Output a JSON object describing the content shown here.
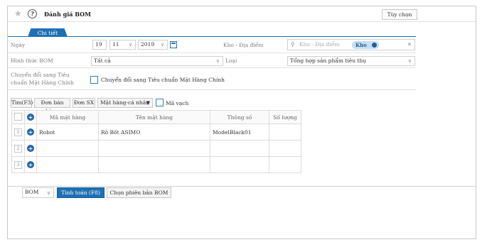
{
  "header": {
    "title": "Đánh giá BOM",
    "options_label": "Tùy chọn",
    "help_glyph": "?",
    "star_glyph": "★"
  },
  "tabs": [
    {
      "label": "Chi tiết"
    }
  ],
  "form": {
    "date_label": "Ngày",
    "date_day": "19",
    "date_month": "11",
    "date_year": "2019",
    "warehouse_label": "Kho - Địa điểm",
    "warehouse_placeholder": "Kho - Địa điểm",
    "warehouse_tag": "Kho",
    "bom_type_label": "Hình thức BOM",
    "bom_type_value": "Tất cả",
    "type_label": "Loại",
    "type_value": "Tổng hợp sản phẩm tiêu thụ",
    "convert_label_1": "Chuyển đổi sang Tiêu",
    "convert_label_2": "chuẩn Mặt Hàng Chính",
    "convert_check_label": "Chuyển đổi sang Tiêu chuẩn Mặt Hàng Chính"
  },
  "toolbar": {
    "search": "Tìm(F3)",
    "sales_order": "Đơn bán hàng",
    "production_order": "Đơn SX",
    "item_personal": "Mặt hàng-cá nhân",
    "barcode": "Mã vạch"
  },
  "table": {
    "columns": [
      "Mã mặt hàng",
      "Tên mặt hàng",
      "Thông số",
      "Số lượng"
    ],
    "rows": [
      {
        "num": "1",
        "code": "Robot",
        "name": "Rô Bốt ASIMO",
        "spec": "ModelBlack01",
        "qty": ""
      },
      {
        "num": "2",
        "code": "",
        "name": "",
        "spec": "",
        "qty": ""
      },
      {
        "num": "3",
        "code": "",
        "name": "",
        "spec": "",
        "qty": ""
      }
    ]
  },
  "footer": {
    "bom_select": "BOM",
    "calculate": "Tính toán (F8)",
    "choose_version": "Chọn phiên bản BOM"
  },
  "colors": {
    "accent": "#1f70b3"
  }
}
